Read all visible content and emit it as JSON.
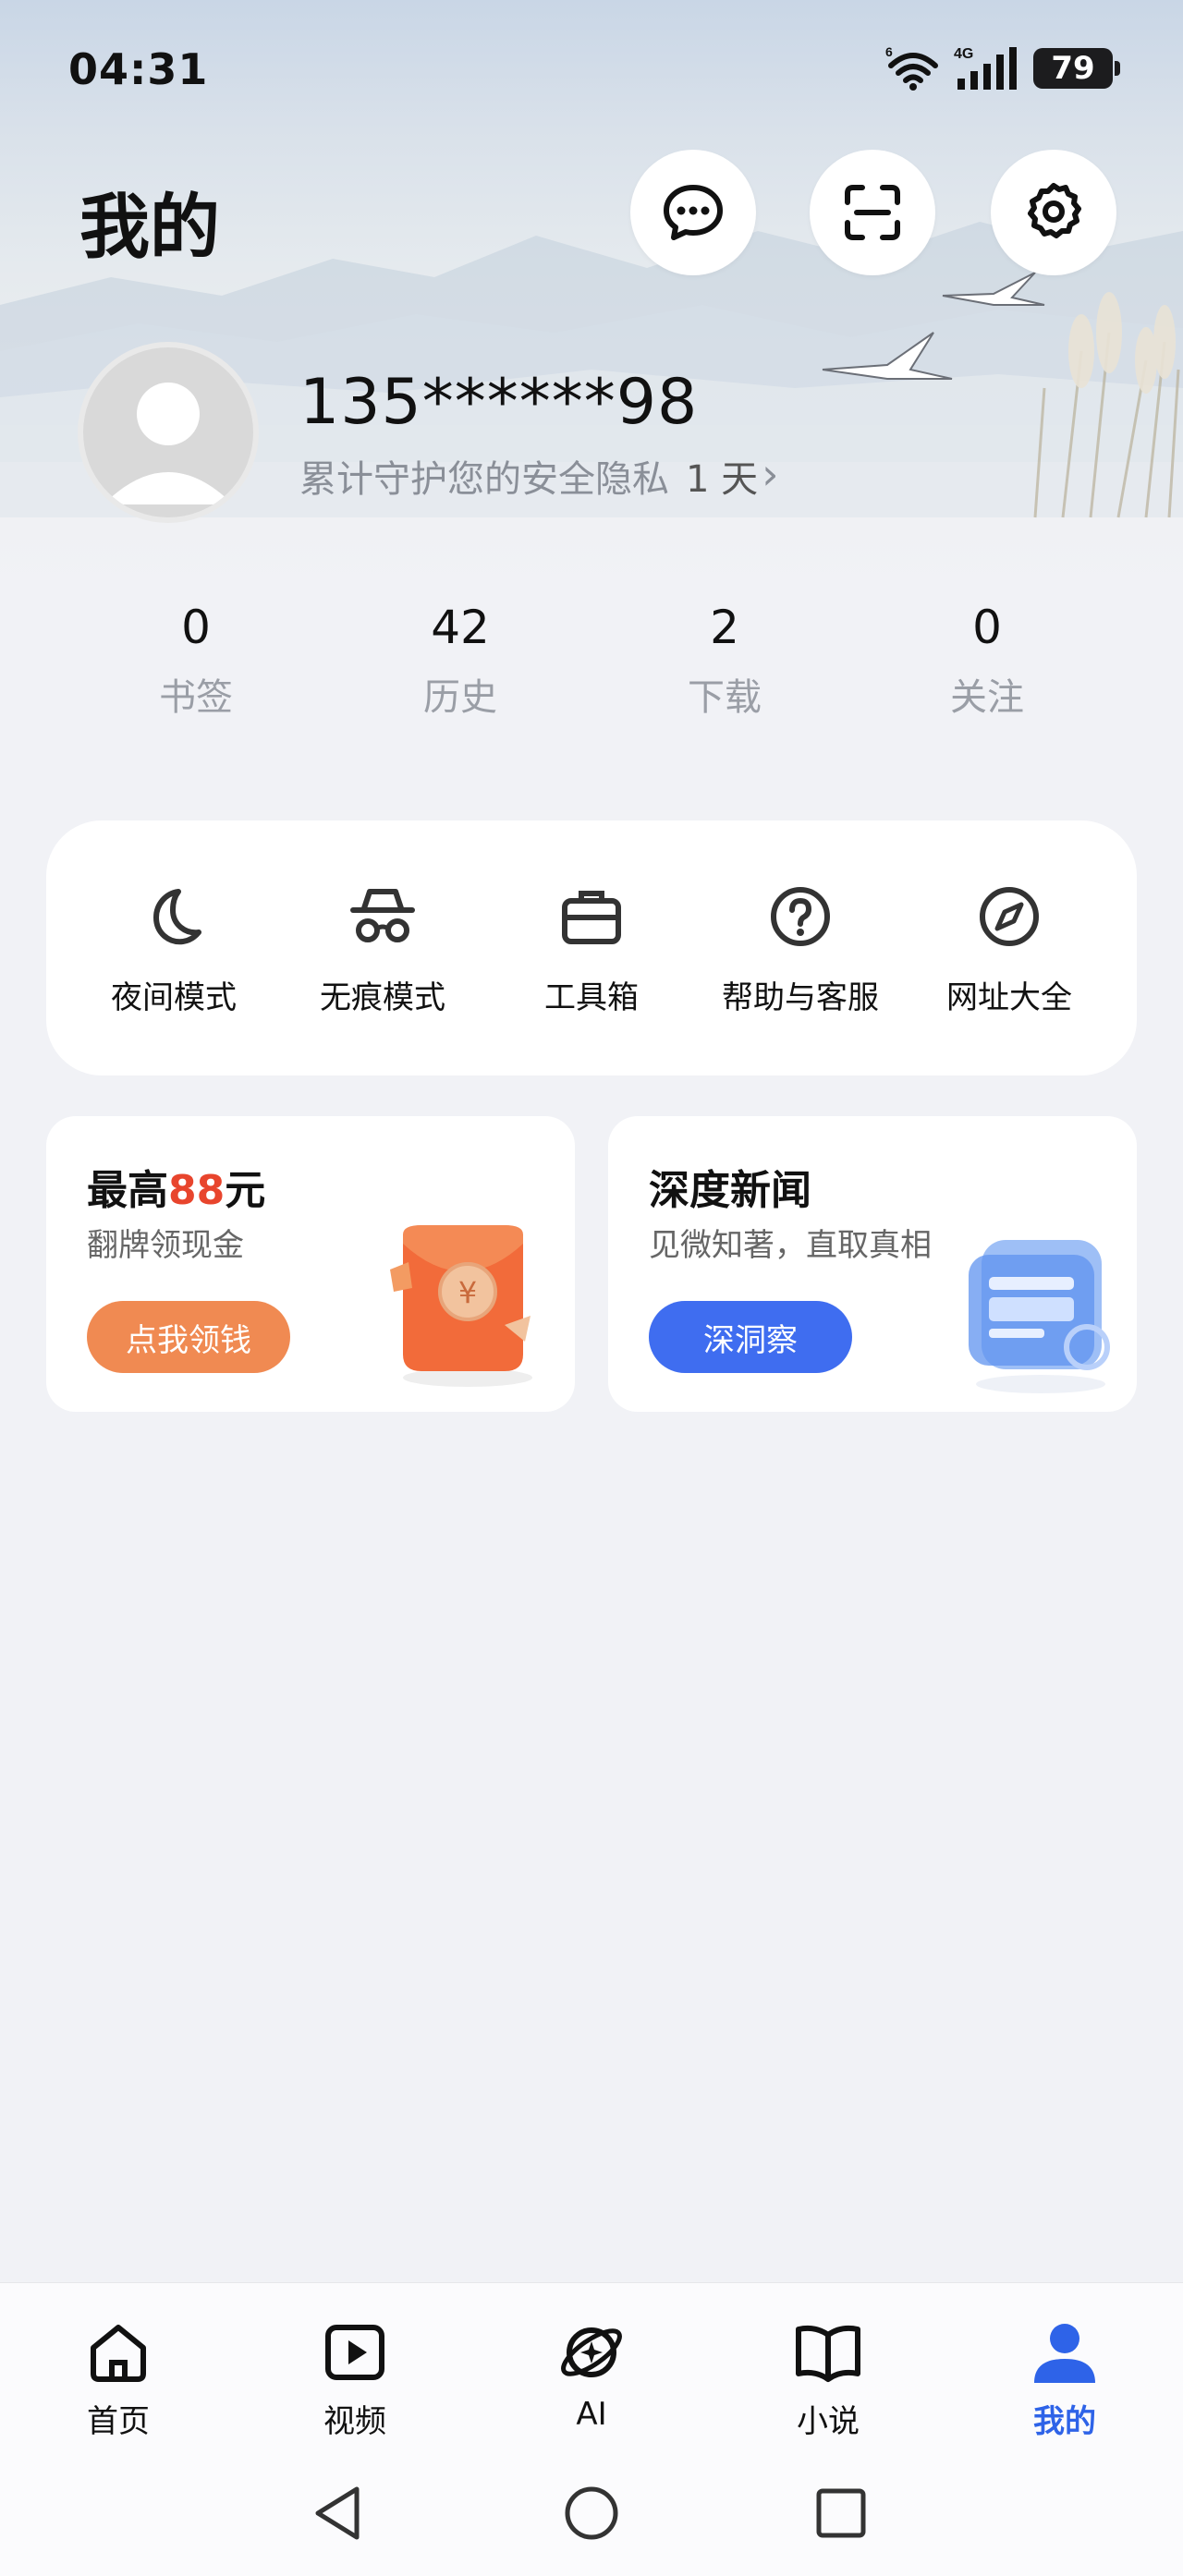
{
  "status_bar": {
    "time": "04:31",
    "network": "4G",
    "wifi_badge": "6",
    "battery": "79"
  },
  "page": {
    "title": "我的"
  },
  "header_actions": [
    {
      "name": "message",
      "icon": "message-bubble-icon"
    },
    {
      "name": "scan",
      "icon": "scan-icon"
    },
    {
      "name": "settings",
      "icon": "gear-icon"
    }
  ],
  "user": {
    "phone": "135******98",
    "subtitle_prefix": "累计守护您的安全隐私",
    "days": "1 天",
    "chevron": "›"
  },
  "stats": [
    {
      "value": "0",
      "label": "书签"
    },
    {
      "value": "42",
      "label": "历史"
    },
    {
      "value": "2",
      "label": "下载"
    },
    {
      "value": "0",
      "label": "关注"
    }
  ],
  "quick_actions": [
    {
      "label": "夜间模式",
      "icon": "moon-icon"
    },
    {
      "label": "无痕模式",
      "icon": "incognito-icon"
    },
    {
      "label": "工具箱",
      "icon": "toolbox-icon"
    },
    {
      "label": "帮助与客服",
      "icon": "help-icon"
    },
    {
      "label": "网址大全",
      "icon": "compass-icon"
    }
  ],
  "promos": {
    "cash": {
      "title_prefix": "最高",
      "title_amount": "88",
      "title_suffix": "元",
      "subtitle": "翻牌领现金",
      "button": "点我领钱",
      "button_color": "#f08a52",
      "amount_color": "#e8452d"
    },
    "news": {
      "title": "深度新闻",
      "subtitle": "见微知著，直取真相",
      "button": "深洞察",
      "button_color": "#3f6df0"
    }
  },
  "bottom_nav": [
    {
      "label": "首页",
      "icon": "home-icon",
      "active": false
    },
    {
      "label": "视频",
      "icon": "video-play-icon",
      "active": false
    },
    {
      "label": "AI",
      "icon": "ai-planet-icon",
      "active": false
    },
    {
      "label": "小说",
      "icon": "book-icon",
      "active": false
    },
    {
      "label": "我的",
      "icon": "user-icon",
      "active": true
    }
  ],
  "colors": {
    "accent": "#2e63e8",
    "background": "#f1f2f6"
  }
}
